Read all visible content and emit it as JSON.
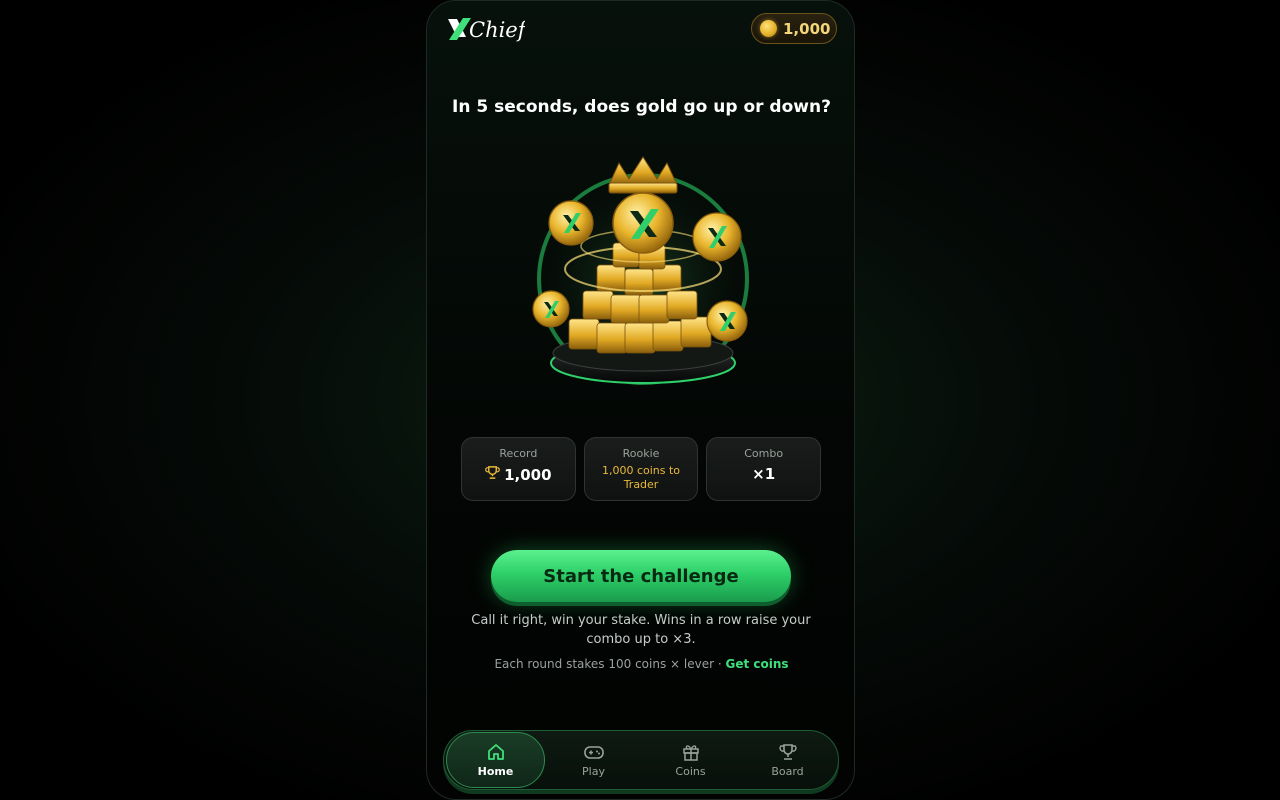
{
  "header": {
    "logo_text": "XChief",
    "balance": "1,000"
  },
  "question": "In 5 seconds, does gold go up or down?",
  "stats": {
    "record_label": "Record",
    "record_value": "1,000",
    "rank_label": "Rookie",
    "rank_note": "1,000 coins to Trader",
    "combo_label": "Combo",
    "combo_value": "×1"
  },
  "cta_label": "Start the challenge",
  "description": "Call it right, win your stake. Wins in a row raise your combo up to ×3.",
  "stake_text": "Each round stakes 100 coins × lever · ",
  "stake_link": "Get coins",
  "nav": {
    "items": [
      {
        "label": "Home",
        "icon": "home-icon",
        "active": true
      },
      {
        "label": "Play",
        "icon": "gamepad-icon",
        "active": false
      },
      {
        "label": "Coins",
        "icon": "gift-icon",
        "active": false
      },
      {
        "label": "Board",
        "icon": "trophy-icon",
        "active": false
      }
    ]
  },
  "colors": {
    "accent_green": "#2ed06a",
    "gold": "#f3d67a",
    "note_gold": "#e8b93a"
  }
}
